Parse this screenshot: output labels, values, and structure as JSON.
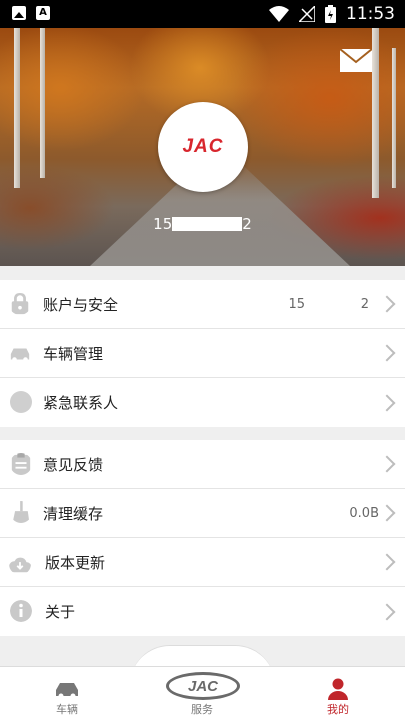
{
  "status_bar": {
    "time": "11:53",
    "left_icons": [
      "image-icon",
      "text-a-icon"
    ],
    "right_icons": [
      "wifi-icon",
      "no-signal-icon",
      "battery-charging-icon"
    ]
  },
  "header": {
    "avatar_logo": "JAC",
    "phone_prefix": "15",
    "phone_suffix": "2",
    "mail_icon": "envelope-icon"
  },
  "menu_groups": [
    [
      {
        "icon": "lock-icon",
        "label": "账户与安全",
        "value_left": "15",
        "value_right": "2"
      },
      {
        "icon": "car-icon",
        "label": "车辆管理"
      },
      {
        "icon": "emergency-contact-icon",
        "label": "紧急联系人"
      }
    ],
    [
      {
        "icon": "feedback-icon",
        "label": "意见反馈"
      },
      {
        "icon": "broom-icon",
        "label": "清理缓存",
        "value": "0.0B"
      },
      {
        "icon": "cloud-download-icon",
        "label": "版本更新"
      },
      {
        "icon": "info-icon",
        "label": "关于"
      }
    ]
  ],
  "tabbar": {
    "tabs": [
      {
        "label": "车辆",
        "icon": "car-icon"
      },
      {
        "label": "服务",
        "icon": "jac-logo-icon"
      },
      {
        "label": "我的",
        "icon": "person-icon"
      }
    ],
    "center_logo": "JAC",
    "active": "我的",
    "accent": "#c0262b"
  },
  "colors": {
    "brand_red": "#d8262d",
    "divider": "#e4e4e4",
    "bg": "#efefef"
  }
}
